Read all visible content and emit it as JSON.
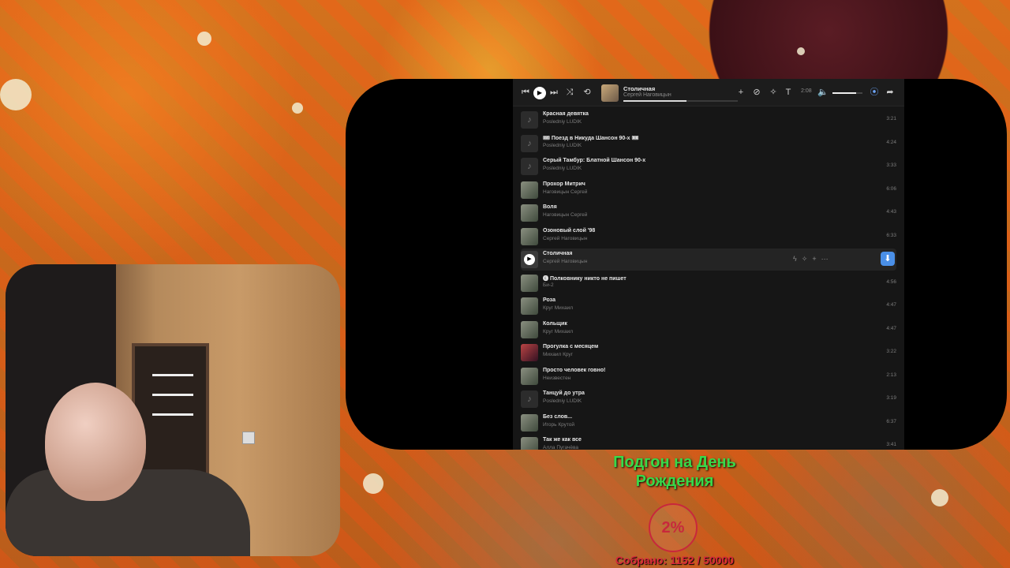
{
  "player": {
    "now_playing": {
      "title": "Столичная",
      "artist": "Сергей Наговицын",
      "progress": 0.55,
      "time": "2:08"
    },
    "volume": 0.8,
    "icons": [
      "prev-icon",
      "play-icon",
      "next-icon",
      "shuffle-icon",
      "repeat-icon",
      "add-icon",
      "dislike-icon",
      "sparkle-icon",
      "text-icon",
      "volume-icon",
      "broadcast-icon",
      "share-icon"
    ]
  },
  "tracks": [
    {
      "title": "Красная девятка",
      "artist": "Posledniy LUDIK",
      "duration": "3:21",
      "cover": "note"
    },
    {
      "title": "🎟 Поезд в Никуда Шансон 90-х 🎟",
      "artist": "Posledniy LUDIK",
      "duration": "4:24",
      "cover": "note"
    },
    {
      "title": "Серый Тамбур: Блатной Шансон 90-х",
      "artist": "Posledniy LUDIK",
      "duration": "3:33",
      "cover": "note"
    },
    {
      "title": "Прохор Митрич",
      "artist": "Наговицын Сергей",
      "duration": "6:06",
      "cover": "photo"
    },
    {
      "title": "Воля",
      "artist": "Наговицын Сергей",
      "duration": "4:43",
      "cover": "photo"
    },
    {
      "title": "Озоновый слой '98",
      "artist": "Сергей Наговицын",
      "duration": "6:33",
      "cover": "photo"
    },
    {
      "title": "Столичная",
      "artist": "Сергей Наговицын",
      "duration": "",
      "cover": "playing"
    },
    {
      "title": "🅔 Полковнику никто не пишет",
      "artist": "Би-2",
      "duration": "4:56",
      "cover": "photo"
    },
    {
      "title": "Роза",
      "artist": "Круг Михаил",
      "duration": "4:47",
      "cover": "photo"
    },
    {
      "title": "Кольщик",
      "artist": "Круг Михаил",
      "duration": "4:47",
      "cover": "photo"
    },
    {
      "title": "Прогулка с месяцем",
      "artist": "Михаил Круг",
      "duration": "3:22",
      "cover": "photo2"
    },
    {
      "title": "Просто человек говно!",
      "artist": "Неизвестен",
      "duration": "2:13",
      "cover": "photo"
    },
    {
      "title": "Танцуй до утра",
      "artist": "Posledniy LUDIK",
      "duration": "3:19",
      "cover": "note"
    },
    {
      "title": "Без слов...",
      "artist": "Игорь Крутой",
      "duration": "6:37",
      "cover": "photo"
    },
    {
      "title": "Так же как все",
      "artist": "Алла Пугачёва",
      "duration": "3:41",
      "cover": "photo"
    }
  ],
  "donation": {
    "title": "Подгон на День Рождения",
    "percent": "2%",
    "collected": "Собрано: 1152 / 50000",
    "accent": "#38d94a",
    "danger": "#c8283c"
  }
}
